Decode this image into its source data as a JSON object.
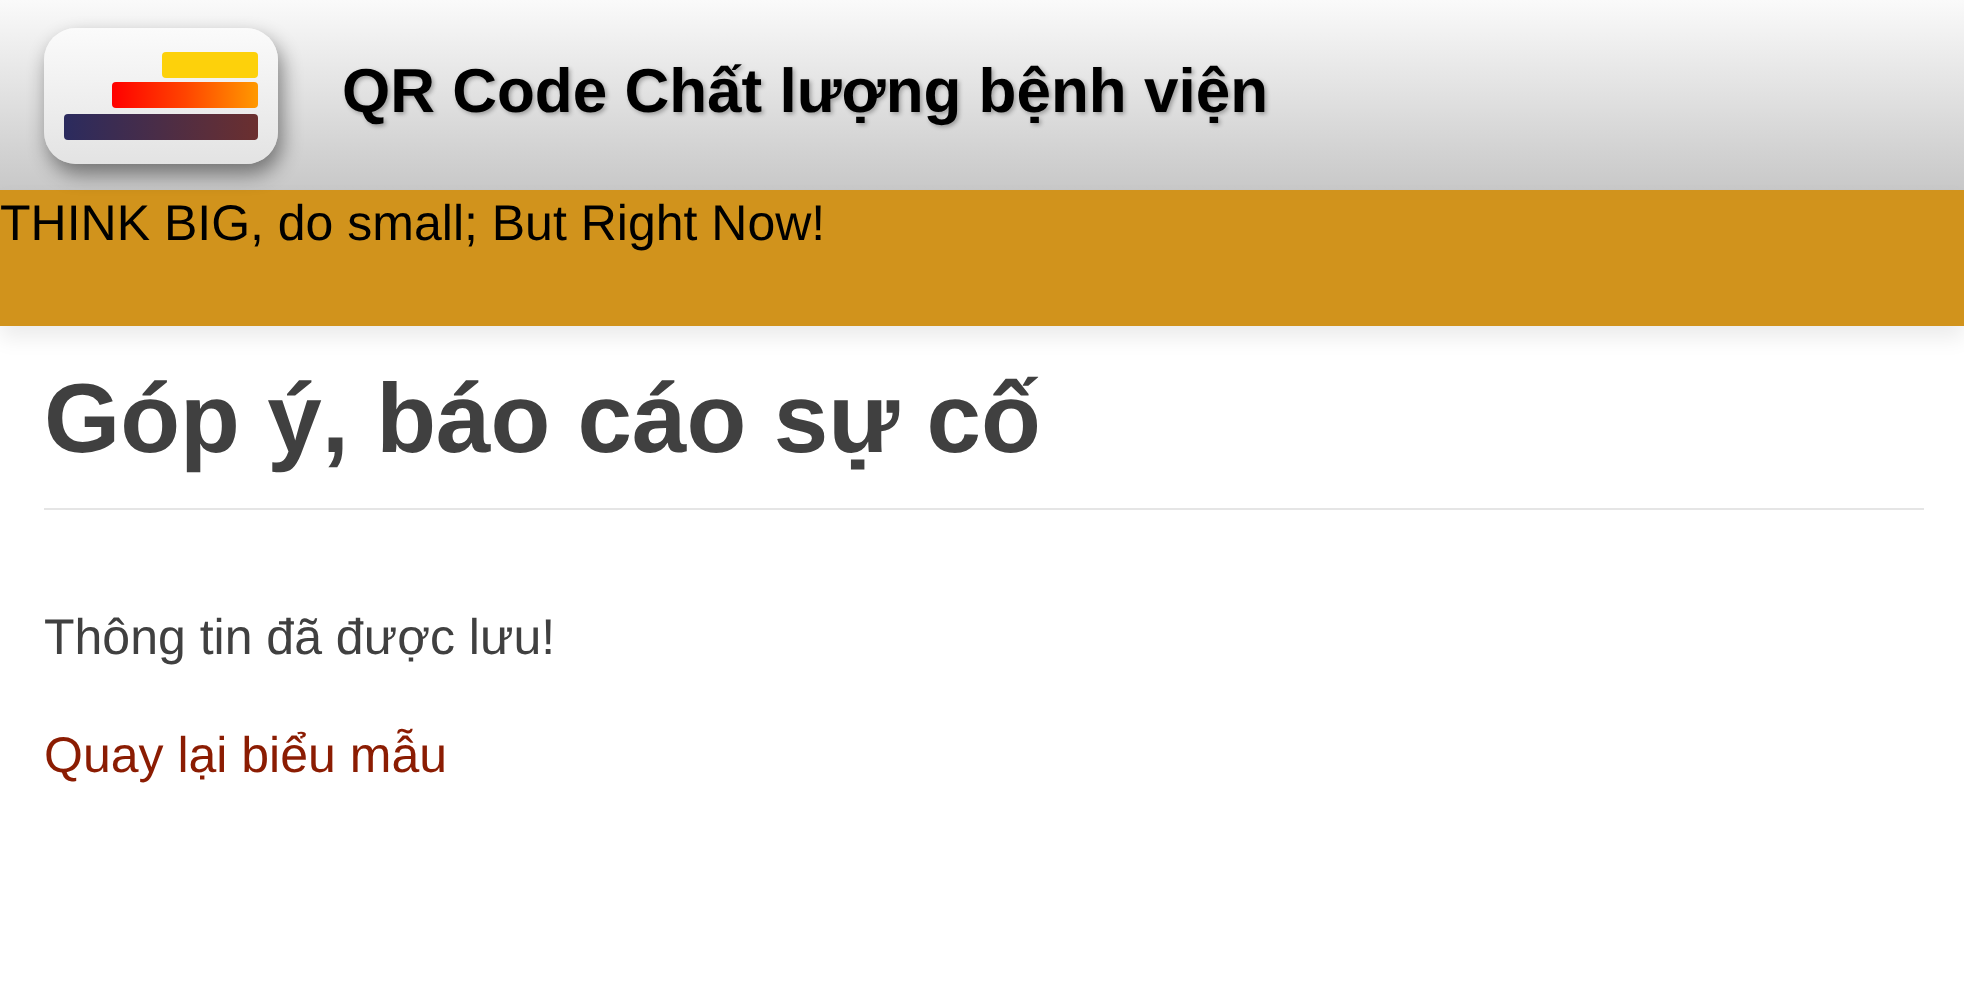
{
  "header": {
    "title": "QR Code Chất lượng bệnh viện"
  },
  "banner": {
    "text": "THINK BIG, do small; But Right Now!"
  },
  "page": {
    "heading": "Góp ý, báo cáo sự cố",
    "message": "Thông tin đã được lưu!",
    "link": "Quay lại biểu mẫu"
  }
}
